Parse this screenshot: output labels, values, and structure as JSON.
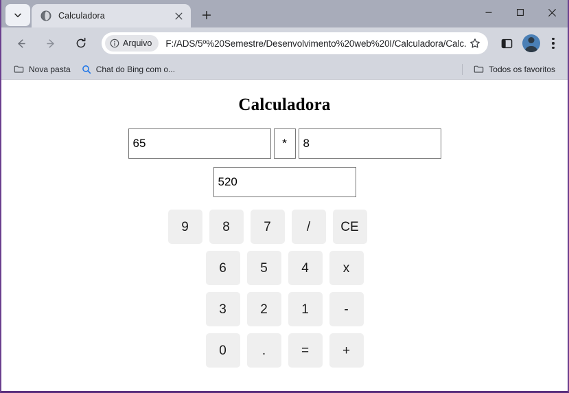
{
  "browser": {
    "tab": {
      "title": "Calculadora",
      "favicon": "globe-icon",
      "close_label": "×"
    },
    "new_tab_label": "+",
    "tab_search_icon": "chevron-down-icon",
    "window_controls": {
      "minimize": "−",
      "maximize": "□",
      "close": "✕"
    },
    "nav": {
      "back": "←",
      "forward": "→",
      "reload": "↻"
    },
    "omnibox": {
      "scheme_chip": "Arquivo",
      "scheme_icon": "info-circle-icon",
      "url": "F:/ADS/5º%20Semestre/Desenvolvimento%20web%20I/Calculadora/Calc...",
      "star_icon": "star-icon"
    },
    "toolbar_icons": {
      "side_panel": "side-panel-icon",
      "profile": "profile-avatar",
      "menu": "three-dot-menu-icon"
    },
    "bookmarks": [
      {
        "label": "Nova pasta",
        "icon": "folder-icon"
      },
      {
        "label": "Chat do Bing com o...",
        "icon": "search-icon"
      }
    ],
    "bookmarks_right": {
      "label": "Todos os favoritos",
      "icon": "folder-icon"
    }
  },
  "app": {
    "title": "Calculadora",
    "fields": {
      "operand_a": "65",
      "operator": "*",
      "operand_b": "8",
      "result": "520"
    },
    "keypad": [
      [
        "9",
        "8",
        "7",
        "/",
        "CE"
      ],
      [
        "6",
        "5",
        "4",
        "x"
      ],
      [
        "3",
        "2",
        "1",
        "-"
      ],
      [
        "0",
        ".",
        "=",
        "+"
      ]
    ]
  },
  "colors": {
    "tabstrip": "#a8acba",
    "toolbar": "#d3d6de",
    "active_tab": "#dfe1e8",
    "key_bg": "#efefef",
    "window_border": "#6b3f8e"
  }
}
